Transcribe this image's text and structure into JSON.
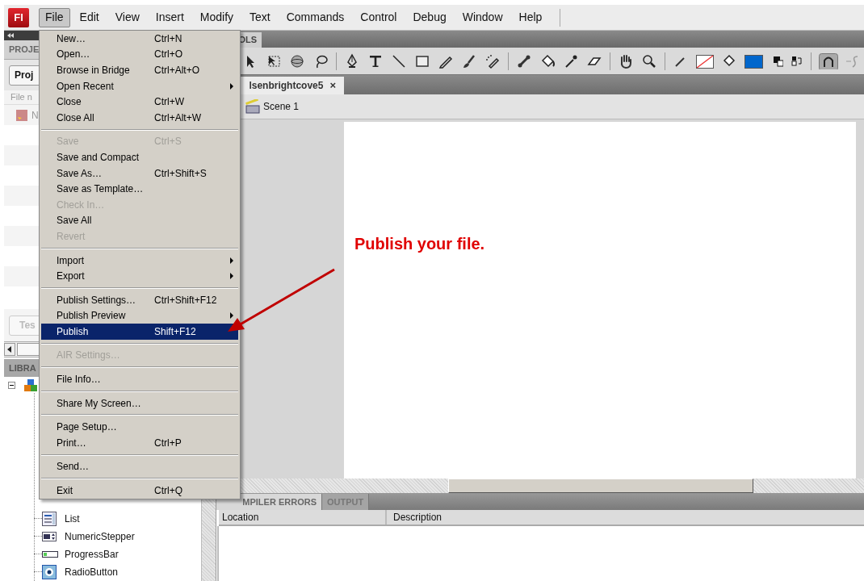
{
  "app_logo": "Fl",
  "menu_bar": [
    {
      "label": "File",
      "selected": true
    },
    {
      "label": "Edit",
      "selected": false
    },
    {
      "label": "View",
      "selected": false
    },
    {
      "label": "Insert",
      "selected": false
    },
    {
      "label": "Modify",
      "selected": false
    },
    {
      "label": "Text",
      "selected": false
    },
    {
      "label": "Commands",
      "selected": false
    },
    {
      "label": "Control",
      "selected": false
    },
    {
      "label": "Debug",
      "selected": false
    },
    {
      "label": "Window",
      "selected": false
    },
    {
      "label": "Help",
      "selected": false
    }
  ],
  "file_menu": [
    {
      "kind": "item",
      "label": "New…",
      "shortcut": "Ctrl+N",
      "disabled": false,
      "submenu": false,
      "selected": false
    },
    {
      "kind": "item",
      "label": "Open…",
      "shortcut": "Ctrl+O",
      "disabled": false,
      "submenu": false,
      "selected": false
    },
    {
      "kind": "item",
      "label": "Browse in Bridge",
      "shortcut": "Ctrl+Alt+O",
      "disabled": false,
      "submenu": false,
      "selected": false
    },
    {
      "kind": "item",
      "label": "Open Recent",
      "disabled": false,
      "submenu": true,
      "selected": false
    },
    {
      "kind": "item",
      "label": "Close",
      "shortcut": "Ctrl+W",
      "disabled": false,
      "submenu": false,
      "selected": false
    },
    {
      "kind": "item",
      "label": "Close All",
      "shortcut": "Ctrl+Alt+W",
      "disabled": false,
      "submenu": false,
      "selected": false
    },
    {
      "kind": "separator"
    },
    {
      "kind": "item",
      "label": "Save",
      "shortcut": "Ctrl+S",
      "disabled": true,
      "submenu": false,
      "selected": false
    },
    {
      "kind": "item",
      "label": "Save and Compact",
      "disabled": false,
      "submenu": false,
      "selected": false
    },
    {
      "kind": "item",
      "label": "Save As…",
      "shortcut": "Ctrl+Shift+S",
      "disabled": false,
      "submenu": false,
      "selected": false
    },
    {
      "kind": "item",
      "label": "Save as Template…",
      "disabled": false,
      "submenu": false,
      "selected": false
    },
    {
      "kind": "item",
      "label": "Check In…",
      "disabled": true,
      "submenu": false,
      "selected": false
    },
    {
      "kind": "item",
      "label": "Save All",
      "disabled": false,
      "submenu": false,
      "selected": false
    },
    {
      "kind": "item",
      "label": "Revert",
      "disabled": true,
      "submenu": false,
      "selected": false
    },
    {
      "kind": "separator"
    },
    {
      "kind": "item",
      "label": "Import",
      "disabled": false,
      "submenu": true,
      "selected": false
    },
    {
      "kind": "item",
      "label": "Export",
      "disabled": false,
      "submenu": true,
      "selected": false
    },
    {
      "kind": "separator"
    },
    {
      "kind": "item",
      "label": "Publish Settings…",
      "shortcut": "Ctrl+Shift+F12",
      "disabled": false,
      "submenu": false,
      "selected": false
    },
    {
      "kind": "item",
      "label": "Publish Preview",
      "disabled": false,
      "submenu": true,
      "selected": false
    },
    {
      "kind": "item",
      "label": "Publish",
      "shortcut": "Shift+F12",
      "disabled": false,
      "submenu": false,
      "selected": true
    },
    {
      "kind": "separator"
    },
    {
      "kind": "item",
      "label": "AIR Settings…",
      "disabled": true,
      "submenu": false,
      "selected": false
    },
    {
      "kind": "separator"
    },
    {
      "kind": "item",
      "label": "File Info…",
      "disabled": false,
      "submenu": false,
      "selected": false
    },
    {
      "kind": "separator"
    },
    {
      "kind": "item",
      "label": "Share My Screen…",
      "disabled": false,
      "submenu": false,
      "selected": false
    },
    {
      "kind": "separator"
    },
    {
      "kind": "item",
      "label": "Page Setup…",
      "disabled": false,
      "submenu": false,
      "selected": false
    },
    {
      "kind": "item",
      "label": "Print…",
      "shortcut": "Ctrl+P",
      "disabled": false,
      "submenu": false,
      "selected": false
    },
    {
      "kind": "separator"
    },
    {
      "kind": "item",
      "label": "Send…",
      "disabled": false,
      "submenu": false,
      "selected": false
    },
    {
      "kind": "separator"
    },
    {
      "kind": "item",
      "label": "Exit",
      "shortcut": "Ctrl+Q",
      "disabled": false,
      "submenu": false,
      "selected": false
    }
  ],
  "project_panel": {
    "title": "PROJE",
    "button": "Proj",
    "column_header": "File n",
    "file_name": "N",
    "test_button": "Tes"
  },
  "library_panel": {
    "title": "LIBRA",
    "root": {
      "expanded": true,
      "children": [
        {
          "label": "List",
          "kind": "list"
        },
        {
          "label": "NumericStepper",
          "kind": "stepper"
        },
        {
          "label": "ProgressBar",
          "kind": "progress"
        },
        {
          "label": "RadioButton",
          "kind": "radio"
        }
      ]
    }
  },
  "tools_tab": "OLS",
  "document_tab": {
    "title": "lsenbrightcove5",
    "close": "×"
  },
  "scene": "Scene 1",
  "output_panel": {
    "tabs": [
      {
        "label": "MPILER ERRORS",
        "selected": true
      },
      {
        "label": "OUTPUT",
        "selected": false
      }
    ],
    "columns": [
      "Location",
      "Description"
    ]
  },
  "annotation": "Publish your file."
}
